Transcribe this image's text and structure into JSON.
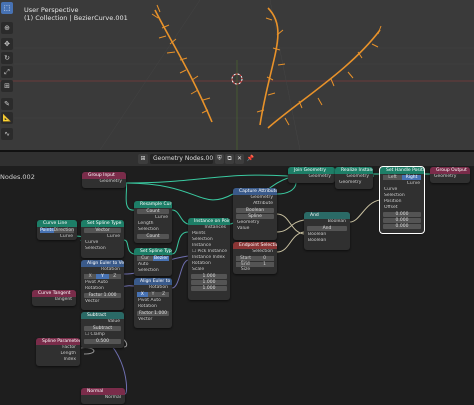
{
  "viewport": {
    "title": "User Perspective",
    "subtitle": "(1) Collection | BezierCurve.001"
  },
  "editor": {
    "tree_name": "Geometry Nodes.002",
    "breadcrumb": "Nodes.002"
  },
  "nodes": {
    "group_input": {
      "title": "Group Input",
      "rows": [
        "Geometry"
      ]
    },
    "group_output": {
      "title": "Group Output",
      "rows": [
        "Geometry"
      ]
    },
    "join_geometry": {
      "title": "Join Geometry",
      "rows": [
        "Geometry"
      ]
    },
    "realize_instances": {
      "title": "Realize Instances",
      "rows": [
        "Geometry",
        "Geometry"
      ]
    },
    "set_handle_positions": {
      "title": "Set Handle Positions",
      "options": [
        "Left",
        "Right"
      ],
      "rows": [
        "Curve",
        "Curve",
        "Selection",
        "Position",
        "Offset"
      ],
      "values": [
        "0.000",
        "0.000",
        "0.000"
      ]
    },
    "resample_curve": {
      "title": "Resample Curve",
      "mode": "Count",
      "rows": [
        "Curve",
        "Curve",
        "Selection"
      ],
      "fields": [
        "Count",
        "Length"
      ],
      "values": [
        "12",
        "0.010"
      ]
    },
    "instance_on_points": {
      "title": "Instance on Points",
      "rows": [
        "Instances",
        "Points",
        "Selection",
        "Instance",
        "Pick Instance",
        "Instance Index",
        "Rotation",
        "Scale"
      ],
      "values": [
        "1.000",
        "1.000",
        "1.000"
      ]
    },
    "capture_attribute": {
      "title": "Capture Attribute",
      "rows": [
        "Geometry",
        "Attribute",
        "Boolean",
        "Spline",
        "Geometry",
        "Value"
      ]
    },
    "endpoint_selection": {
      "title": "Endpoint Selection",
      "rows": [
        "Selection"
      ],
      "fields": [
        "Start Size",
        "End Size"
      ],
      "values": [
        "0",
        "1"
      ]
    },
    "and_node": {
      "title": "And",
      "rows": [
        "Boolean",
        "And",
        "Boolean",
        "Boolean"
      ]
    },
    "curve_line": {
      "title": "Curve Line",
      "options": [
        "Points",
        "Direction"
      ],
      "rows": [
        "Curve"
      ]
    },
    "set_spline_type": {
      "title": "Set Spline Type",
      "mode": "Vector",
      "rows": [
        "Curve",
        "Curve",
        "Selection"
      ]
    },
    "set_spline_type2": {
      "title": "Set Spline Type",
      "options": [
        "Cur",
        "Bezier"
      ],
      "rows": [
        "Auto",
        "Selection"
      ]
    },
    "align_euler_1": {
      "title": "Align Euler to Vector",
      "options": [
        "X",
        "Y",
        "Z"
      ],
      "rows": [
        "Rotation",
        "Pivot",
        "Auto",
        "Rotation",
        "Factor",
        "Vector"
      ],
      "values": [
        "1.000"
      ]
    },
    "align_euler_2": {
      "title": "Align Euler to Vector",
      "options": [
        "X",
        "Y",
        "Z"
      ],
      "rows": [
        "Rotation",
        "Pivot",
        "Auto",
        "Rotation",
        "Factor",
        "Vector"
      ],
      "values": [
        "1.000"
      ]
    },
    "curve_tangent": {
      "title": "Curve Tangent",
      "rows": [
        "Tangent"
      ]
    },
    "subtract": {
      "title": "Subtract",
      "rows": [
        "Value",
        "Subtract",
        "Clamp",
        "Value"
      ],
      "values": [
        "0.500"
      ]
    },
    "spline_parameter": {
      "title": "Spline Parameter",
      "rows": [
        "Factor",
        "Length",
        "Index"
      ]
    },
    "normal": {
      "title": "Normal",
      "rows": [
        "Normal"
      ]
    }
  },
  "colors": {
    "geometry_header": "#1d7e67",
    "vector_header": "#3a5a8a",
    "input_header": "#7a2c4a",
    "function_header": "#2a6a66",
    "curve_color": "#e8922a",
    "link_geometry": "#3ac9a0",
    "link_value": "#9a9a9a"
  }
}
